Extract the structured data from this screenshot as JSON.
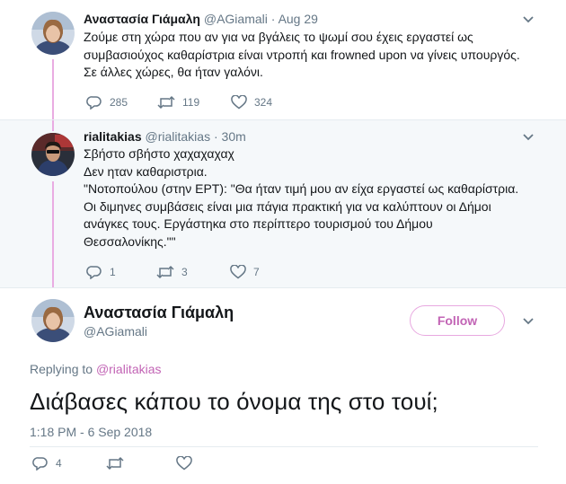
{
  "tweet1": {
    "name": "Αναστασία Γιάμαλη",
    "handle": "@AGiamali",
    "separator": "·",
    "time": "Aug 29",
    "text_lines": [
      "Ζούμε στη χώρα που αν για να βγάλεις το ψωμί σου έχεις εργαστεί ως",
      "συμβασιούχος καθαρίστρια είναι ντροπή και frowned upon να γίνεις υπουργός.",
      "Σε άλλες χώρες, θα ήταν γαλόνι."
    ],
    "replies": "285",
    "retweets": "119",
    "likes": "324"
  },
  "tweet2": {
    "name": "rialitakias",
    "handle": "@rialitakias",
    "separator": "·",
    "time": "30m",
    "text_lines": [
      "Σβήστο σβήστο χαχαχαχαχ",
      "Δεν ηταν καθαριστρια.",
      "\"Νοτοπούλου (στην ΕΡΤ): \"Θα ήταν τιμή μου αν είχα εργαστεί ως καθαρίστρια.",
      "Οι διμηνες συμβάσεις είναι μια πάγια πρακτική για να καλύπτουν οι Δήμοι",
      "ανάγκες τους. Εργάστηκα στο περίπτερο τουρισμού του Δήμου",
      "Θεσσαλονίκης.\"\""
    ],
    "replies": "1",
    "retweets": "3",
    "likes": "7"
  },
  "tweet3": {
    "name": "Αναστασία Γιάμαλη",
    "handle": "@AGiamali",
    "follow_label": "Follow",
    "replying_prefix": "Replying to",
    "replying_mention": "@rialitakias",
    "text": "Διάβασες κάπου το όνομα της στο τουί;",
    "timestamp": "1:18 PM - 6 Sep 2018",
    "replies": "4"
  },
  "colors": {
    "accent": "#c264b5",
    "thread_line": "#e8a8e0",
    "muted": "#657786",
    "text": "#14171a",
    "highlight_bg": "#f5f8fa"
  },
  "icons": [
    "reply-icon",
    "retweet-icon",
    "like-icon",
    "chevron-down-icon"
  ]
}
